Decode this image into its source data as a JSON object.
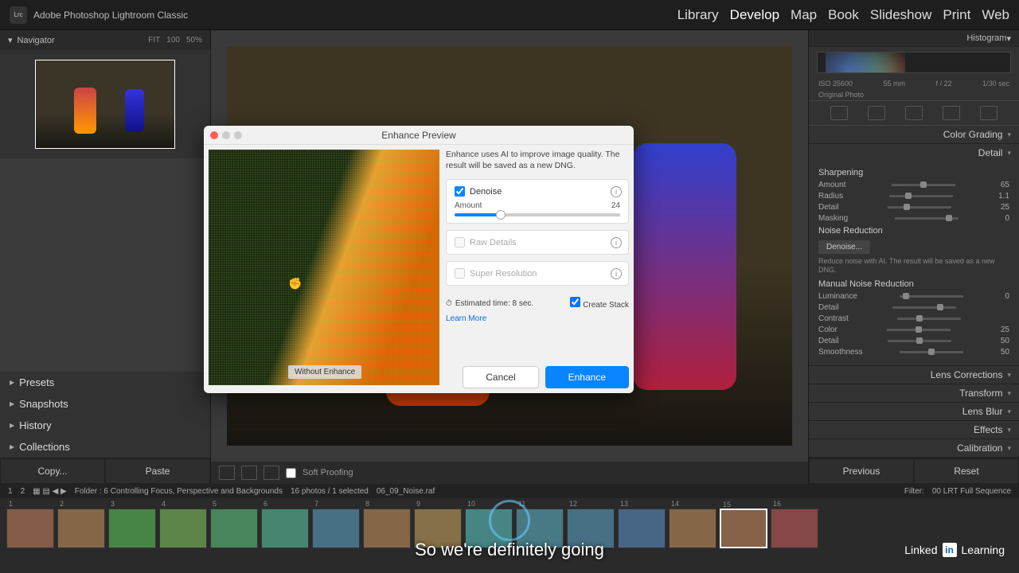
{
  "app": {
    "logo_text": "Lrc",
    "name": "Adobe Photoshop\nLightroom Classic"
  },
  "modules": [
    "Library",
    "Develop",
    "Map",
    "Book",
    "Slideshow",
    "Print",
    "Web"
  ],
  "active_module": "Develop",
  "navigator": {
    "title": "Navigator",
    "zoom_levels": [
      "FIT",
      "100",
      "50%"
    ]
  },
  "left_sections": [
    "Presets",
    "Snapshots",
    "History",
    "Collections"
  ],
  "copy_paste": {
    "copy": "Copy...",
    "paste": "Paste"
  },
  "toolbar": {
    "soft_proofing": "Soft Proofing"
  },
  "histogram": {
    "title": "Histogram",
    "info_left": "ISO 25600",
    "info_mid": "55 mm",
    "info_f": "f / 22",
    "info_t": "1/30 sec",
    "original": "Original Photo"
  },
  "right_sections": {
    "color_grading": "Color Grading",
    "detail": {
      "title": "Detail",
      "sharpening": "Sharpening",
      "rows": [
        {
          "label": "Amount",
          "value": "65",
          "pos": 45
        },
        {
          "label": "Radius",
          "value": "1.1",
          "pos": 25
        },
        {
          "label": "Detail",
          "value": "25",
          "pos": 25
        },
        {
          "label": "Masking",
          "value": "0",
          "pos": 80
        }
      ],
      "noise_reduction": "Noise Reduction",
      "denoise_btn": "Denoise...",
      "denoise_desc": "Reduce noise with AI. The result will be saved as a new DNG.",
      "manual_nr": "Manual Noise Reduction",
      "manual_rows": [
        {
          "label": "Luminance",
          "value": "0",
          "pos": 5
        },
        {
          "label": "Detail",
          "value": "",
          "pos": 70
        },
        {
          "label": "Contrast",
          "value": "",
          "pos": 30
        },
        {
          "label": "Color",
          "value": "25",
          "pos": 45
        },
        {
          "label": "Detail",
          "value": "50",
          "pos": 45
        },
        {
          "label": "Smoothness",
          "value": "50",
          "pos": 45
        }
      ]
    },
    "collapsed": [
      "Lens Corrections",
      "Transform",
      "Lens Blur",
      "Effects",
      "Calibration"
    ]
  },
  "prev_reset": {
    "previous": "Previous",
    "reset": "Reset"
  },
  "dialog": {
    "title": "Enhance Preview",
    "description": "Enhance uses AI to improve image quality. The result will be saved as a new DNG.",
    "denoise": {
      "label": "Denoise",
      "checked": true,
      "amount_label": "Amount",
      "amount_value": "24"
    },
    "raw_details": "Raw Details",
    "super_resolution": "Super Resolution",
    "estimated_time": "Estimated time: 8 sec.",
    "create_stack": "Create Stack",
    "learn_more": "Learn More",
    "cancel": "Cancel",
    "enhance": "Enhance",
    "preview_label": "Without Enhance"
  },
  "filmstrip_info": {
    "page_1": "1",
    "page_2": "2",
    "folder": "Folder : 6 Controlling Focus, Perspective and Backgrounds",
    "count": "16 photos / 1 selected",
    "file": "06_09_Noise.raf",
    "filter_label": "Filter:",
    "filter_value": "00 LRT Full Sequence"
  },
  "filmstrip": {
    "thumbs": [
      "1",
      "2",
      "3",
      "4",
      "5",
      "6",
      "7",
      "8",
      "9",
      "10",
      "11",
      "12",
      "13",
      "14",
      "15",
      "16"
    ],
    "selected_index": 14
  },
  "linkedin": "Learning",
  "subtitle": "So we're definitely going"
}
